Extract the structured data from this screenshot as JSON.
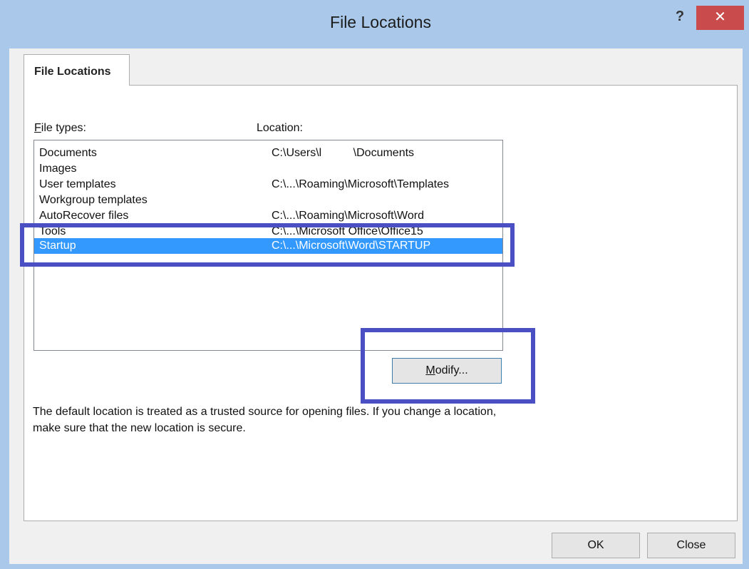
{
  "window": {
    "title": "File Locations",
    "help_label": "?",
    "close_label": "✕"
  },
  "tab": {
    "label": "File Locations"
  },
  "labels": {
    "file_types_first": "F",
    "file_types_rest": "ile types:",
    "location": "Location:"
  },
  "list": {
    "rows": [
      {
        "type": "Documents",
        "location": "C:\\Users\\l          \\Documents"
      },
      {
        "type": "Images",
        "location": ""
      },
      {
        "type": "User templates",
        "location": "C:\\...\\Roaming\\Microsoft\\Templates"
      },
      {
        "type": "Workgroup templates",
        "location": ""
      },
      {
        "type": "AutoRecover files",
        "location": "C:\\...\\Roaming\\Microsoft\\Word"
      },
      {
        "type": "Tools",
        "location": "C:\\...\\Microsoft Office\\Office15"
      },
      {
        "type": "Startup",
        "location": "C:\\...\\Microsoft\\Word\\STARTUP"
      }
    ],
    "selected_index": 6
  },
  "buttons": {
    "modify_first": "M",
    "modify_rest": "odify...",
    "ok": "OK",
    "close": "Close"
  },
  "info": {
    "text": "The default location is treated as a trusted source for opening files. If you change a location, make sure that the new location is secure."
  },
  "colors": {
    "title_bar": "#a9c8ea",
    "close_button": "#c94b4b",
    "selection": "#3399ff",
    "annotation_box": "#4a4fc4"
  }
}
